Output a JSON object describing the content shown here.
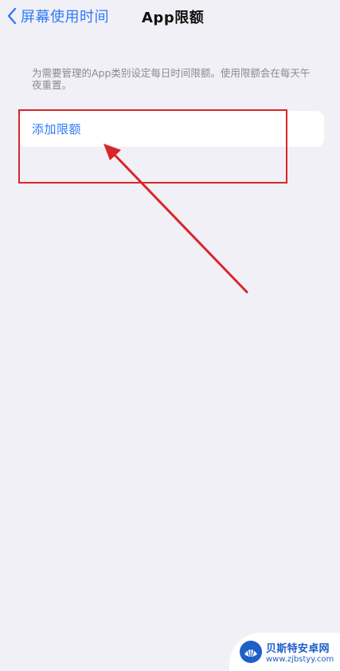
{
  "nav": {
    "back_label": "屏幕使用时间",
    "title": "App限额"
  },
  "description": "为需要管理的App类别设定每日时间限额。使用限额会在每天午夜重置。",
  "card": {
    "add_label": "添加限额"
  },
  "annotation": {
    "color": "#d9252a"
  },
  "watermark": {
    "title": "贝斯特安卓网",
    "url": "www.zjbstyy.com"
  },
  "colors": {
    "accent": "#2f7bf6",
    "background": "#f1f0f6"
  }
}
